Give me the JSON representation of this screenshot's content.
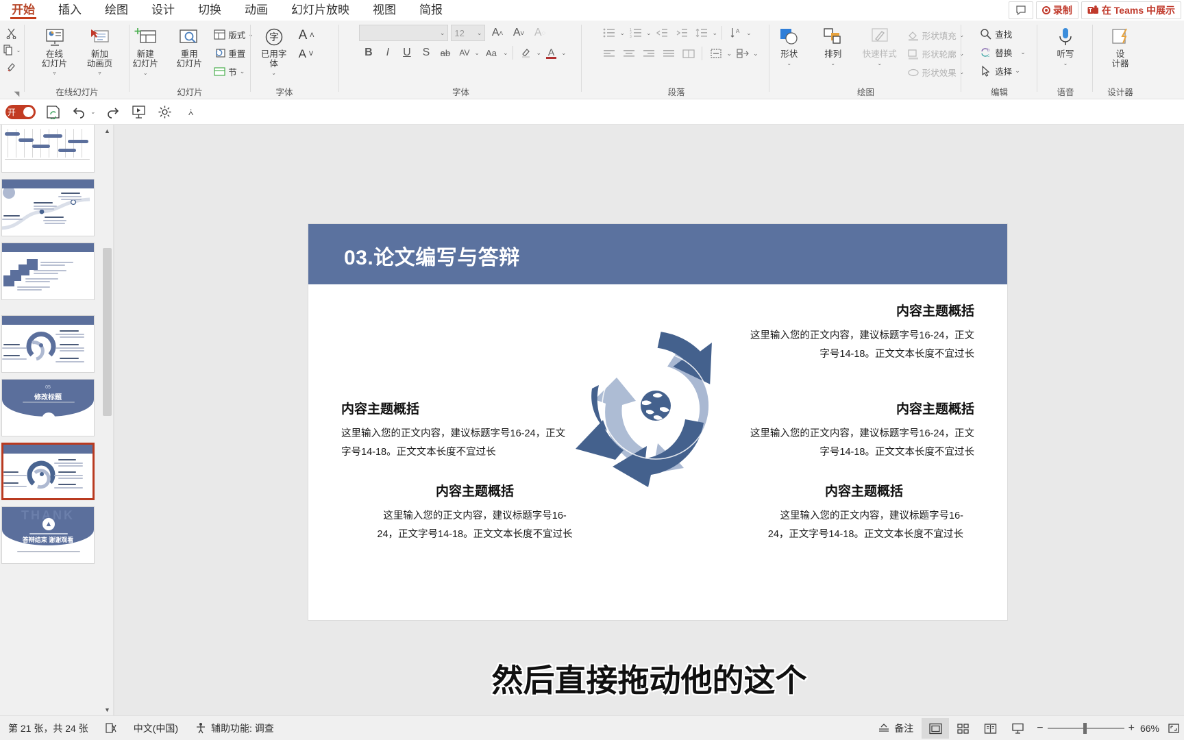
{
  "ribbon": {
    "tabs": [
      {
        "label": "开始",
        "active": true
      },
      {
        "label": "插入",
        "active": false
      },
      {
        "label": "绘图",
        "active": false
      },
      {
        "label": "设计",
        "active": false
      },
      {
        "label": "切换",
        "active": false
      },
      {
        "label": "动画",
        "active": false
      },
      {
        "label": "幻灯片放映",
        "active": false
      },
      {
        "label": "视图",
        "active": false
      },
      {
        "label": "简报",
        "active": false
      }
    ],
    "right_buttons": [
      {
        "label": "",
        "icon": "comment-icon",
        "kind": "plain"
      },
      {
        "label": "录制",
        "icon": "record-icon",
        "kind": "accent"
      },
      {
        "label": "在 Teams 中展示",
        "icon": "teams-icon",
        "kind": "accent"
      }
    ],
    "groups": [
      {
        "name": "clipboard",
        "label": "",
        "items": [
          {
            "label": "",
            "icon": "cut-icon"
          },
          {
            "label": "",
            "icon": "copy-icon"
          },
          {
            "label": "",
            "icon": "format-painter-icon"
          }
        ]
      },
      {
        "name": "online-slides",
        "label": "在线幻灯片",
        "items": [
          {
            "label": "在线\n幻灯片",
            "icon": "online-slide-icon"
          },
          {
            "label": "新加\n动画页",
            "icon": "add-animation-page-icon"
          }
        ]
      },
      {
        "name": "slides",
        "label": "幻灯片",
        "items": [
          {
            "label": "新建\n幻灯片",
            "icon": "new-slide-icon"
          },
          {
            "label": "重用\n幻灯片",
            "icon": "reuse-slide-icon"
          },
          {
            "label": "版式",
            "icon": "layout-icon"
          },
          {
            "label": "重置",
            "icon": "reset-icon"
          },
          {
            "label": "节",
            "icon": "section-icon"
          }
        ]
      },
      {
        "name": "font-used",
        "label": "字体",
        "items": [
          {
            "label": "已用字\n体",
            "icon": "used-font-icon"
          },
          {
            "label": "",
            "icon": "grow-font-icon"
          },
          {
            "label": "",
            "icon": "shrink-font-icon"
          }
        ]
      },
      {
        "name": "font",
        "label": "字体",
        "font_name": "",
        "font_name_placeholder": "",
        "font_size": "12",
        "items": [
          {
            "label": "B",
            "icon": "bold-icon"
          },
          {
            "label": "I",
            "icon": "italic-icon"
          },
          {
            "label": "U",
            "icon": "underline-icon"
          },
          {
            "label": "S",
            "icon": "shadow-icon"
          },
          {
            "label": "ab",
            "icon": "strikethrough-icon"
          },
          {
            "label": "AV",
            "icon": "character-spacing-icon"
          },
          {
            "label": "Aa",
            "icon": "change-case-icon"
          },
          {
            "label": "",
            "icon": "text-highlight-icon"
          },
          {
            "label": "A",
            "icon": "font-color-icon"
          }
        ]
      },
      {
        "name": "paragraph",
        "label": "段落",
        "items": [
          {
            "label": "",
            "icon": "bullets-icon"
          },
          {
            "label": "",
            "icon": "numbering-icon"
          },
          {
            "label": "",
            "icon": "decrease-indent-icon"
          },
          {
            "label": "",
            "icon": "increase-indent-icon"
          },
          {
            "label": "",
            "icon": "line-spacing-icon"
          },
          {
            "label": "",
            "icon": "text-direction-icon"
          },
          {
            "label": "",
            "icon": "align-left-icon"
          },
          {
            "label": "",
            "icon": "align-center-icon"
          },
          {
            "label": "",
            "icon": "align-right-icon"
          },
          {
            "label": "",
            "icon": "justify-icon"
          },
          {
            "label": "",
            "icon": "columns-icon"
          },
          {
            "label": "",
            "icon": "align-text-icon"
          },
          {
            "label": "",
            "icon": "convert-smartart-icon"
          }
        ]
      },
      {
        "name": "drawing",
        "label": "绘图",
        "items": [
          {
            "label": "形状",
            "icon": "shapes-icon"
          },
          {
            "label": "排列",
            "icon": "arrange-icon"
          },
          {
            "label": "快速样式",
            "icon": "quick-styles-icon",
            "disabled": true
          },
          {
            "label": "形状填充",
            "icon": "shape-fill-icon",
            "disabled": true
          },
          {
            "label": "形状轮廓",
            "icon": "shape-outline-icon",
            "disabled": true
          },
          {
            "label": "形状效果",
            "icon": "shape-effects-icon",
            "disabled": true
          }
        ]
      },
      {
        "name": "editing",
        "label": "编辑",
        "items": [
          {
            "label": "查找",
            "icon": "search-icon"
          },
          {
            "label": "替换",
            "icon": "replace-icon"
          },
          {
            "label": "选择",
            "icon": "select-icon"
          }
        ]
      },
      {
        "name": "voice",
        "label": "语音",
        "items": [
          {
            "label": "听写",
            "icon": "dictate-microphone-icon"
          }
        ]
      },
      {
        "name": "designer",
        "label": "设计器",
        "items": [
          {
            "label": "设\n计器",
            "icon": "designer-idea-icon"
          }
        ]
      }
    ]
  },
  "qat": {
    "toggle_label": "开",
    "buttons": [
      {
        "icon": "autosave-toggle"
      },
      {
        "icon": "save-sync-icon"
      },
      {
        "icon": "undo-icon"
      },
      {
        "icon": "redo-icon"
      },
      {
        "icon": "start-slideshow-icon"
      },
      {
        "icon": "gear-icon"
      },
      {
        "icon": "customize-qat-chevron-icon"
      }
    ]
  },
  "thumbnails": {
    "selected_index": 5,
    "items": [
      {
        "kind": "gantt",
        "title": ""
      },
      {
        "kind": "curve",
        "title": ""
      },
      {
        "kind": "cards",
        "title": ""
      },
      {
        "kind": "arcs",
        "title": ""
      },
      {
        "kind": "section",
        "title": "修改标题",
        "number": "05"
      },
      {
        "kind": "cycle",
        "title": ""
      },
      {
        "kind": "thanks",
        "title": "答辩结束 谢谢观看",
        "watermark": "THANK"
      }
    ]
  },
  "slide": {
    "title": "03.论文编写与答辩",
    "title_bar_color": "#5b729f",
    "diagram": {
      "name": "circular-arrow-diagram",
      "center_icon": "globe-icon",
      "arrow_dark": "#4a6591",
      "arrow_light": "#a9b8d2"
    },
    "blocks": [
      {
        "id": "top-right",
        "heading": "内容主题概括",
        "body": "这里输入您的正文内容，建议标题字号16-24，正文字号14-18。正文文本长度不宜过长",
        "align": "right"
      },
      {
        "id": "mid-left",
        "heading": "内容主题概括",
        "body": "这里输入您的正文内容，建议标题字号16-24，正文字号14-18。正文文本长度不宜过长",
        "align": "left"
      },
      {
        "id": "mid-right",
        "heading": "内容主题概括",
        "body": "这里输入您的正文内容，建议标题字号16-24，正文字号14-18。正文文本长度不宜过长",
        "align": "right"
      },
      {
        "id": "bottom-left",
        "heading": "内容主题概括",
        "body": "这里输入您的正文内容，建议标题字号16-24，正文字号14-18。正文文本长度不宜过长",
        "align": "left"
      },
      {
        "id": "bottom-right",
        "heading": "内容主题概括",
        "body": "这里输入您的正文内容，建议标题字号16-24，正文字号14-18。正文文本长度不宜过长",
        "align": "right"
      }
    ]
  },
  "caption": "然后直接拖动他的这个",
  "statusbar": {
    "slide_count": "第 21 张，共 24 张",
    "language": "中文(中国)",
    "accessibility": "辅助功能: 调查",
    "notes_label": "备注",
    "views": [
      {
        "name": "normal-view",
        "icon": "normal-view-icon",
        "active": true
      },
      {
        "name": "slide-sorter-view",
        "icon": "slide-sorter-icon",
        "active": false
      },
      {
        "name": "reading-view",
        "icon": "reading-view-icon",
        "active": false
      },
      {
        "name": "slideshow-view",
        "icon": "slideshow-icon",
        "active": false
      }
    ],
    "zoom_level": "66%",
    "zoom_out": "−",
    "zoom_in": "+"
  }
}
